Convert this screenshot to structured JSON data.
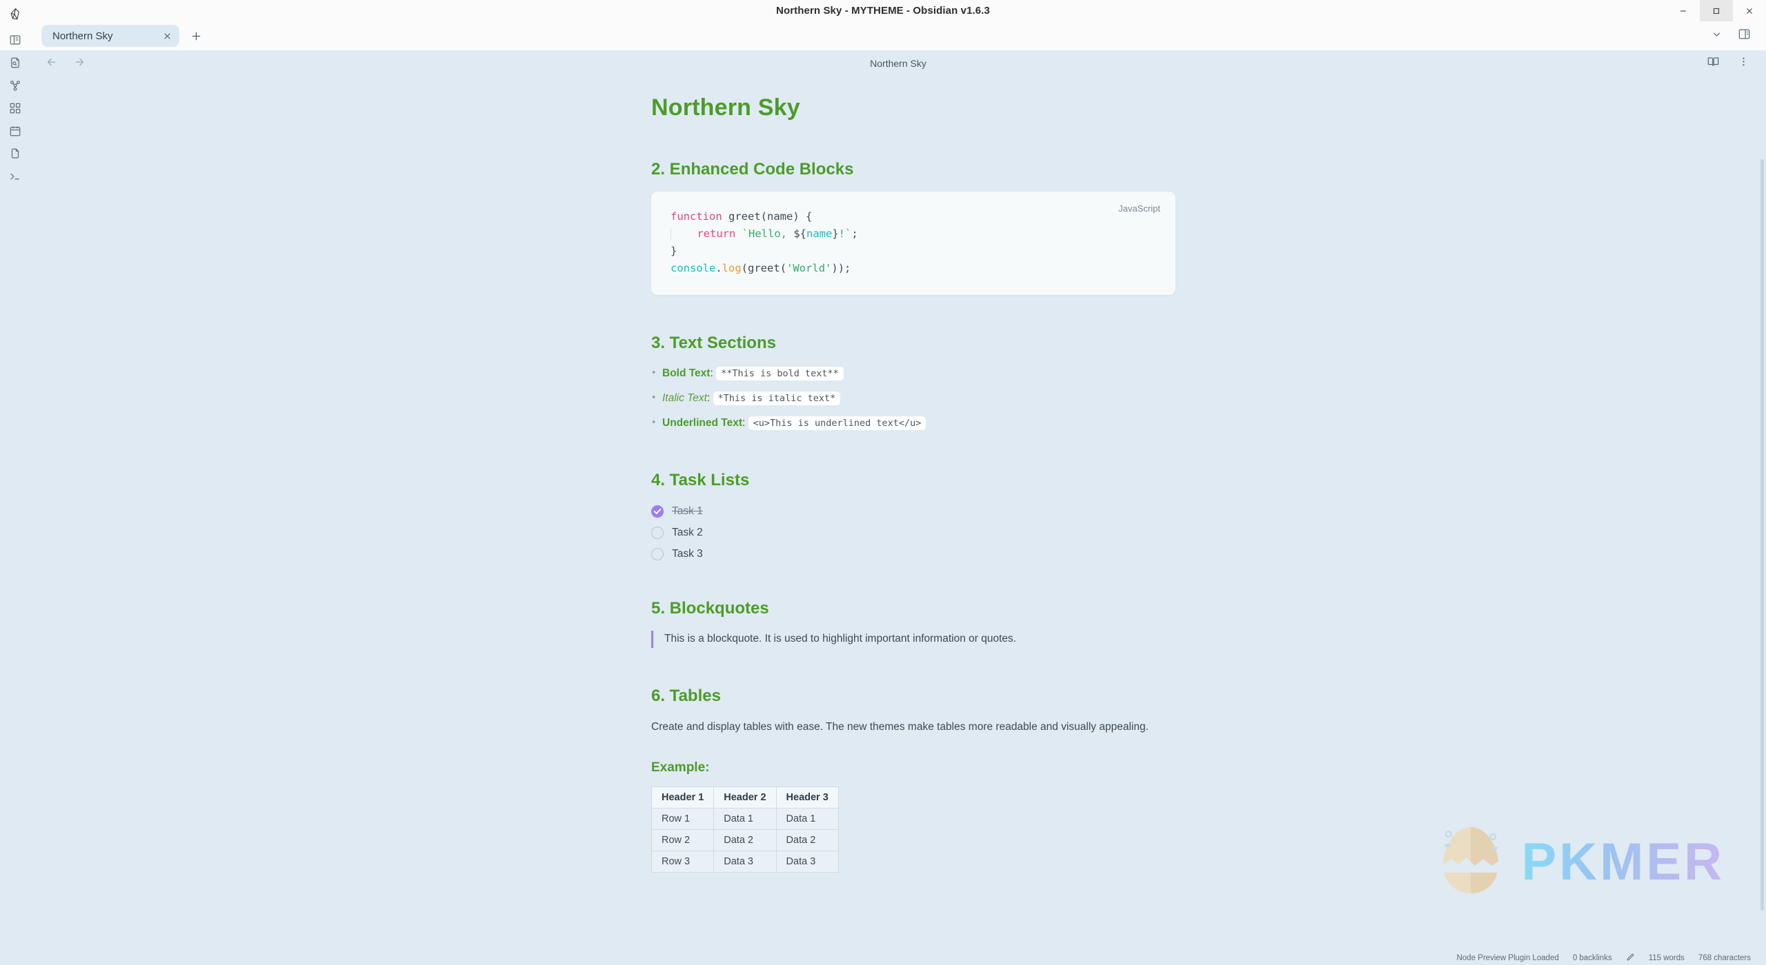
{
  "window": {
    "title": "Northern Sky - MYTHEME - Obsidian v1.6.3",
    "minimize_label": "—",
    "maximize_label": "□",
    "close_label": "✕"
  },
  "ribbon": {
    "logo": "obsidian-logo",
    "items": [
      {
        "name": "toggle-left-sidebar",
        "icon": "sidebar-icon"
      },
      {
        "name": "quick-switcher",
        "icon": "file-search-icon"
      },
      {
        "name": "graph-view",
        "icon": "graph-icon"
      },
      {
        "name": "canvas",
        "icon": "grid-icon"
      },
      {
        "name": "daily-note",
        "icon": "calendar-icon"
      },
      {
        "name": "templates",
        "icon": "files-icon"
      },
      {
        "name": "terminal",
        "icon": "terminal-icon"
      }
    ]
  },
  "tabbar": {
    "tab_title": "Northern Sky",
    "close_icon": "close-icon",
    "new_tab_icon": "plus-icon",
    "chevron_icon": "chevron-down-icon",
    "right_sidebar_icon": "right-sidebar-icon"
  },
  "viewheader": {
    "back_icon": "arrow-left-icon",
    "forward_icon": "arrow-right-icon",
    "title": "Northern Sky",
    "reading_view_icon": "book-open-icon",
    "more_options_icon": "more-vertical-icon"
  },
  "note": {
    "title": "Northern Sky",
    "sections": {
      "code_blocks": {
        "heading": "2. Enhanced Code Blocks",
        "language": "JavaScript",
        "lines": [
          {
            "tokens": [
              {
                "t": "function",
                "c": "kw"
              },
              {
                "t": " ",
                "c": "pun"
              },
              {
                "t": "greet",
                "c": "fn"
              },
              {
                "t": "(name) {",
                "c": "pun"
              }
            ]
          },
          {
            "indent": true,
            "tokens": [
              {
                "t": "    ",
                "c": "pun"
              },
              {
                "t": "return",
                "c": "kw"
              },
              {
                "t": " ",
                "c": "pun"
              },
              {
                "t": "`Hello, ",
                "c": "str"
              },
              {
                "t": "${",
                "c": "pun"
              },
              {
                "t": "name",
                "c": "var"
              },
              {
                "t": "}",
                "c": "pun"
              },
              {
                "t": "!`",
                "c": "str"
              },
              {
                "t": ";",
                "c": "pun"
              }
            ]
          },
          {
            "tokens": [
              {
                "t": "}",
                "c": "pun"
              }
            ]
          },
          {
            "tokens": [
              {
                "t": "console",
                "c": "obj"
              },
              {
                "t": ".",
                "c": "pun"
              },
              {
                "t": "log",
                "c": "mth"
              },
              {
                "t": "(",
                "c": "pun"
              },
              {
                "t": "greet",
                "c": "fn"
              },
              {
                "t": "(",
                "c": "pun"
              },
              {
                "t": "'World'",
                "c": "str"
              },
              {
                "t": "));",
                "c": "pun"
              }
            ]
          }
        ]
      },
      "text_sections": {
        "heading": "3. Text Sections",
        "items": [
          {
            "label": "Bold Text",
            "style": "bold",
            "sep": ": ",
            "code": "**This is bold text**"
          },
          {
            "label": "Italic Text",
            "style": "italic",
            "sep": ": ",
            "code": "*This is italic text*"
          },
          {
            "label": "Underlined Text",
            "style": "bold",
            "sep": ": ",
            "code": "<u>This is underlined text</u>"
          }
        ]
      },
      "task_lists": {
        "heading": "4. Task Lists",
        "tasks": [
          {
            "label": "Task 1",
            "checked": true
          },
          {
            "label": "Task 2",
            "checked": false
          },
          {
            "label": "Task 3",
            "checked": false
          }
        ]
      },
      "blockquotes": {
        "heading": "5. Blockquotes",
        "quote": "This is a blockquote. It is used to highlight important information or quotes."
      },
      "tables": {
        "heading": "6. Tables",
        "paragraph": "Create and display tables with ease. The new themes make tables more readable and visually appealing.",
        "example_heading": "Example:",
        "table": {
          "headers": [
            "Header 1",
            "Header 2",
            "Header 3"
          ],
          "rows": [
            [
              "Row 1",
              "Data 1",
              "Data 1"
            ],
            [
              "Row 2",
              "Data 2",
              "Data 2"
            ],
            [
              "Row 3",
              "Data 3",
              "Data 3"
            ]
          ]
        }
      }
    }
  },
  "watermark": {
    "text": "PKMER",
    "logo": "cracked-egg-icon"
  },
  "statusbar": {
    "plugin_status": "Node Preview Plugin Loaded",
    "backlinks": "0 backlinks",
    "edit_icon": "pencil-icon",
    "words": "115 words",
    "characters": "768 characters"
  },
  "colors": {
    "heading_green": "#4c9c28",
    "accent_purple": "#9c7ef0",
    "editor_bg": "#dfeaf2",
    "chrome_bg": "#fbfbfc",
    "tab_bg": "#dbe9f4"
  }
}
